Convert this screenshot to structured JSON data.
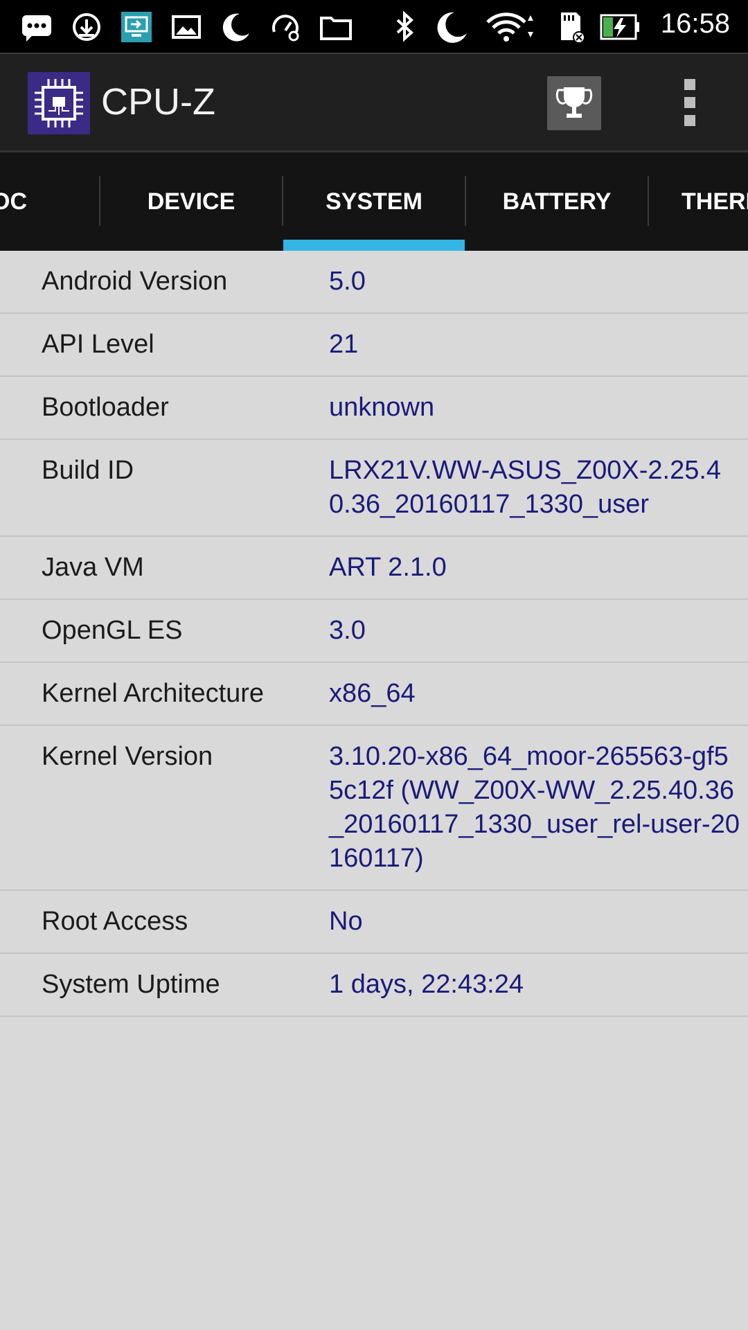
{
  "status_bar": {
    "time": "16:58",
    "icons": [
      "message-icon",
      "download-icon",
      "screen-share-icon",
      "image-icon",
      "moon-icon",
      "speedometer-icon",
      "folder-icon",
      "bluetooth-icon",
      "do-not-disturb-icon",
      "wifi-icon",
      "sd-card-icon",
      "battery-charging-icon"
    ]
  },
  "app": {
    "title": "CPU-Z",
    "logo_icon": "cpu-chip-icon",
    "trophy_icon": "trophy-icon",
    "menu_icon": "overflow-menu-icon"
  },
  "tabs": [
    {
      "label": "OC"
    },
    {
      "label": "DEVICE"
    },
    {
      "label": "SYSTEM",
      "selected": true
    },
    {
      "label": "BATTERY"
    },
    {
      "label": "THERI"
    }
  ],
  "colors": {
    "accent": "#33b5e5",
    "value_text": "#1a1a7a",
    "background": "#d9d9d9"
  },
  "rows": [
    {
      "label": "Android Version",
      "value": "5.0"
    },
    {
      "label": "API Level",
      "value": "21"
    },
    {
      "label": "Bootloader",
      "value": "unknown"
    },
    {
      "label": "Build ID",
      "value": "LRX21V.WW-ASUS_Z00X-2.25.40.36_20160117_1330_user"
    },
    {
      "label": "Java VM",
      "value": "ART 2.1.0"
    },
    {
      "label": "OpenGL ES",
      "value": "3.0"
    },
    {
      "label": "Kernel Architecture",
      "value": "x86_64"
    },
    {
      "label": "Kernel Version",
      "value": "3.10.20-x86_64_moor-265563-gf55c12f (WW_Z00X-WW_2.25.40.36_20160117_1330_user_rel-user-20160117)"
    },
    {
      "label": "Root Access",
      "value": "No"
    },
    {
      "label": "System Uptime",
      "value": "1 days, 22:43:24"
    }
  ]
}
